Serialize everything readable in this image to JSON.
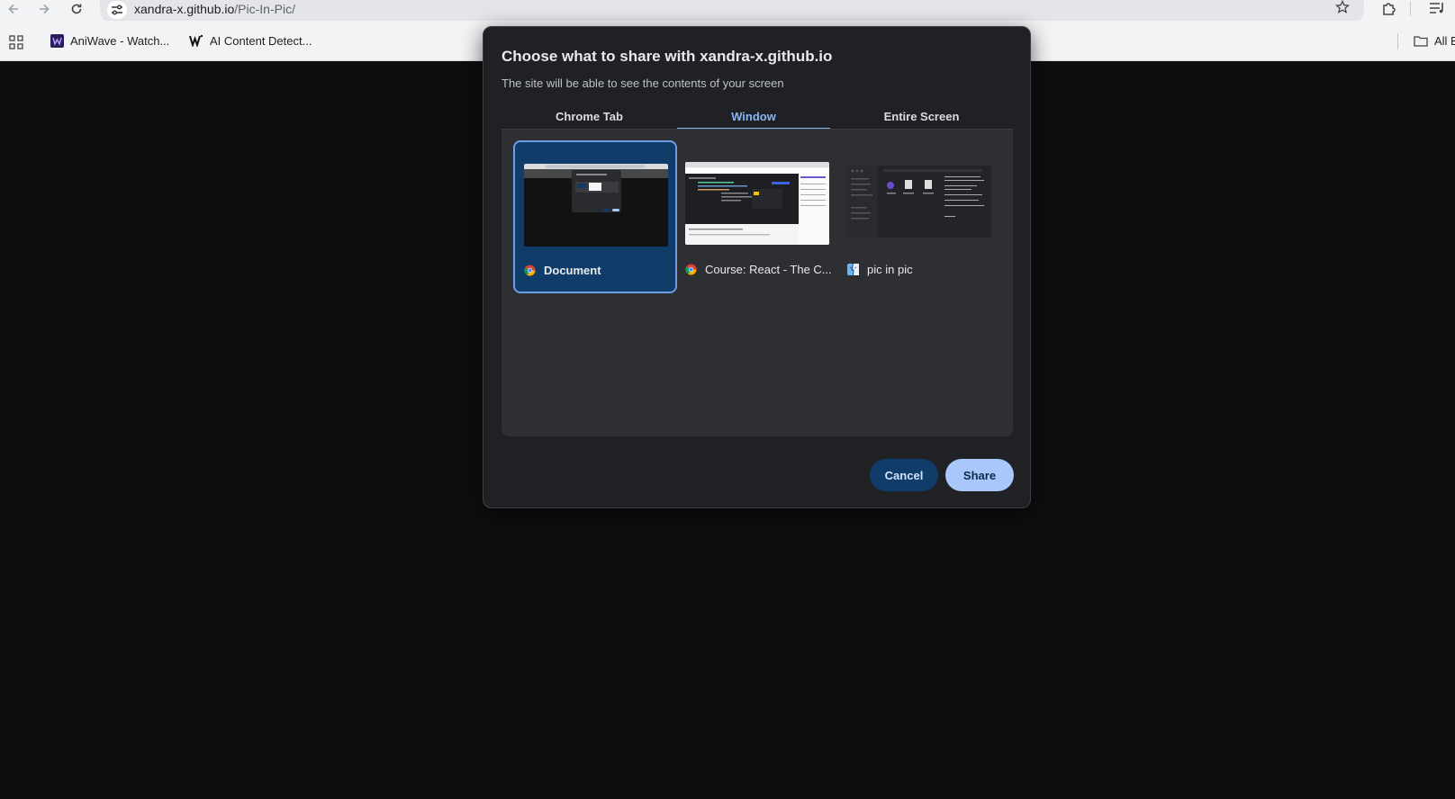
{
  "browser": {
    "url_host": "xandra-x.github.io",
    "url_path": "/Pic-In-Pic/",
    "icons": {
      "back": "back-arrow-icon",
      "forward": "forward-arrow-icon",
      "reload": "reload-icon",
      "site_info": "tune-icon",
      "bookmark": "star-icon",
      "extensions": "puzzle-icon",
      "reading_list": "reading-list-icon"
    }
  },
  "bookmarks_bar": {
    "items": [
      {
        "label": "AniWave - Watch...",
        "icon": "aniwave-favicon"
      },
      {
        "label": "AI Content Detect...",
        "icon": "w-favicon"
      }
    ],
    "all_bookmarks_label": "All B"
  },
  "dialog": {
    "title": "Choose what to share with xandra-x.github.io",
    "subtitle": "The site will be able to see the contents of your screen",
    "tabs": [
      {
        "label": "Chrome Tab",
        "active": false
      },
      {
        "label": "Window",
        "active": true
      },
      {
        "label": "Entire Screen",
        "active": false
      }
    ],
    "windows": [
      {
        "label": "Document",
        "icon": "chrome-icon",
        "selected": true
      },
      {
        "label": "Course: React - The C...",
        "icon": "chrome-icon",
        "selected": false
      },
      {
        "label": "pic in pic",
        "icon": "finder-icon",
        "selected": false
      }
    ],
    "cancel_label": "Cancel",
    "share_label": "Share"
  },
  "colors": {
    "accent": "#8ab4f8",
    "selected_card": "#0f3c68",
    "share_button": "#a8c7fa",
    "dialog_bg": "#202124",
    "page_bg": "#0e0e0e"
  }
}
